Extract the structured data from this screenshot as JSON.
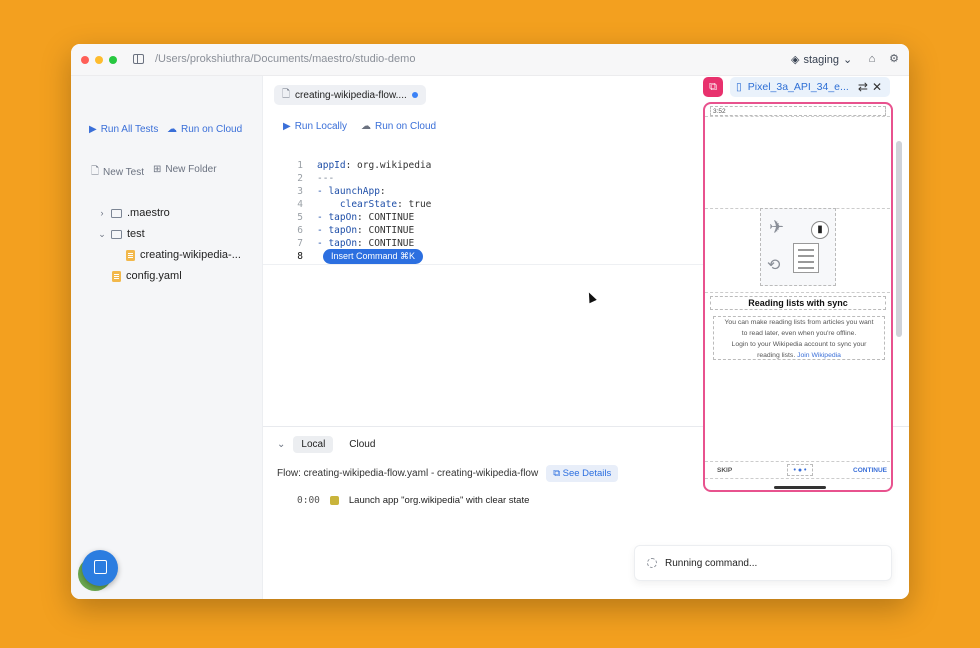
{
  "window": {
    "path": "/Users/prokshiuthra/Documents/maestro/studio-demo",
    "environment": "staging"
  },
  "sidebar": {
    "run_all_tests": "Run All Tests",
    "run_on_cloud": "Run on Cloud",
    "new_test": "New Test",
    "new_folder": "New Folder",
    "tree": [
      {
        "label": ".maestro",
        "type": "folder",
        "expanded": false
      },
      {
        "label": "test",
        "type": "folder",
        "expanded": true
      },
      {
        "label": "creating-wikipedia-...",
        "type": "file"
      },
      {
        "label": "config.yaml",
        "type": "file"
      }
    ]
  },
  "editor": {
    "tab_label": "creating-wikipedia-flow....",
    "run_locally": "Run Locally",
    "run_on_cloud": "Run on Cloud",
    "code": [
      {
        "ln": "1",
        "key": "appId",
        "value": ": org.wikipedia"
      },
      {
        "ln": "2",
        "text": "---"
      },
      {
        "ln": "3",
        "key": "- launchApp",
        "value": ":"
      },
      {
        "ln": "4",
        "key": "    clearState",
        "value": ": true"
      },
      {
        "ln": "5",
        "key": "- tapOn",
        "value": ": CONTINUE"
      },
      {
        "ln": "6",
        "key": "- tapOn",
        "value": ": CONTINUE"
      },
      {
        "ln": "7",
        "key": "- tapOn",
        "value": ": CONTINUE"
      },
      {
        "ln": "8",
        "text": ""
      }
    ],
    "insert_command": "Insert Command ⌘K"
  },
  "bottom_panel": {
    "tabs": [
      "Local",
      "Cloud"
    ],
    "flow_text": "Flow: creating-wikipedia-flow.yaml - creating-wikipedia-flow",
    "see_details": "See Details",
    "log": {
      "time": "0:00",
      "text": "Launch app \"org.wikipedia\" with clear state"
    },
    "running": "Running command..."
  },
  "device": {
    "name": "Pixel_3a_API_34_e...",
    "status_time": "3:52",
    "title": "Reading lists with sync",
    "body_line1": "You can make reading lists from articles you want",
    "body_line2": "to read later, even when you're offline.",
    "body_line3": "Login to your Wikipedia account to sync your",
    "body_line4": "reading lists.",
    "body_link": "Join Wikipedia",
    "skip": "SKIP",
    "continue": "CONTINUE"
  },
  "colors": {
    "accent": "#2c6fe0",
    "device_border": "#e8528e",
    "background": "#f3a01f"
  }
}
